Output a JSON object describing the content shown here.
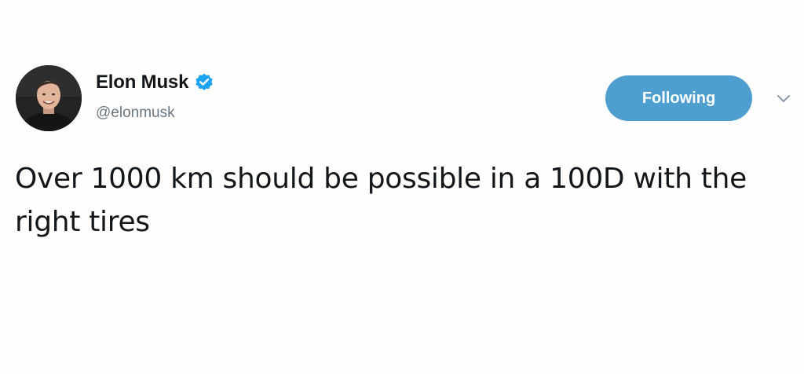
{
  "user": {
    "display_name": "Elon Musk",
    "handle": "@elonmusk",
    "verified": true,
    "avatar_icon": "profile-photo"
  },
  "follow_button": {
    "label": "Following",
    "color": "#4e9fd0"
  },
  "menu": {
    "icon": "chevron-down-icon"
  },
  "tweet": {
    "text": "Over 1000 km should be possible in a 100D with the right tires"
  },
  "colors": {
    "verified_badge": "#1da1f2",
    "text": "#14171a",
    "handle": "#6b7680"
  }
}
